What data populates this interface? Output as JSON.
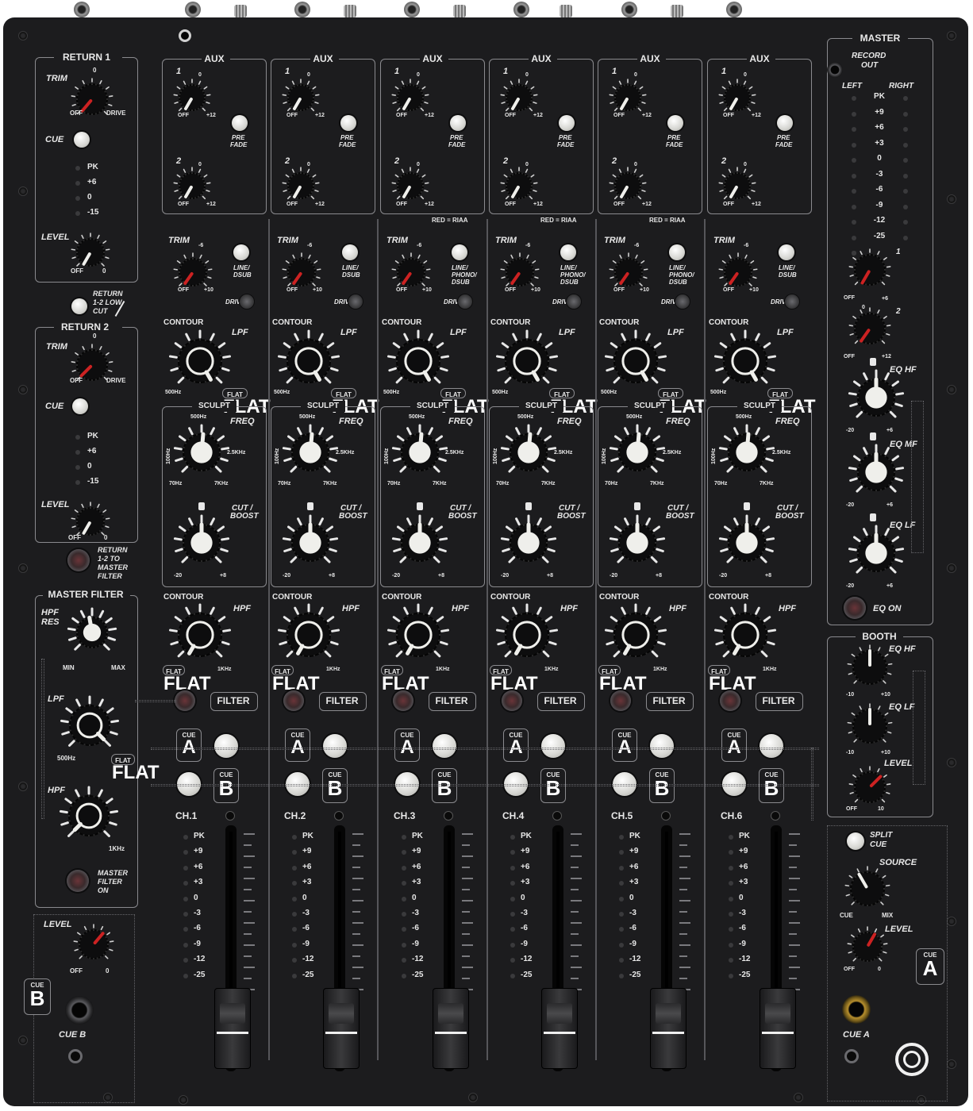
{
  "returns": {
    "r1": {
      "title": "RETURN 1",
      "trim": "TRIM",
      "trim_zero": "0",
      "off": "OFF",
      "drive": "DRIVE",
      "cue": "CUE",
      "meter": [
        "PK",
        "+6",
        "0",
        "-15"
      ],
      "level": "LEVEL",
      "level_off": "OFF",
      "level_zero": "0"
    },
    "r2": {
      "title": "RETURN 2",
      "trim": "TRIM",
      "trim_zero": "0",
      "off": "OFF",
      "drive": "DRIVE",
      "cue": "CUE",
      "meter": [
        "PK",
        "+6",
        "0",
        "-15"
      ],
      "level": "LEVEL",
      "level_off": "OFF",
      "level_zero": "0"
    },
    "low_cut": [
      "RETURN",
      "1-2 LOW",
      "CUT"
    ],
    "to_master": [
      "RETURN",
      "1-2 TO",
      "MASTER",
      "FILTER"
    ]
  },
  "master_filter": {
    "title": "MASTER FILTER",
    "hpf_res": [
      "HPF",
      "RES"
    ],
    "min": "MIN",
    "max": "MAX",
    "lpf": "LPF",
    "lpf_min": "500Hz",
    "flat": "FLAT",
    "hpf": "HPF",
    "hpf_max": "1KHz",
    "on": [
      "MASTER",
      "FILTER",
      "ON"
    ]
  },
  "cue_b_section": {
    "level": "LEVEL",
    "off": "OFF",
    "zero": "0",
    "cue_small": "CUE",
    "cue_letter": "B",
    "jack": "CUE B"
  },
  "channel": {
    "aux_title": "AUX",
    "aux1": "1",
    "aux2": "2",
    "off": "OFF",
    "plus12": "+12",
    "zero": "0",
    "pre_fade": [
      "PRE",
      "FADE"
    ],
    "red_riaa": "RED = RIAA",
    "trim": "TRIM",
    "trim_min": "-6",
    "trim_off": "OFF",
    "trim_max": "+10",
    "drive": "DRIVE",
    "contour": "CONTOUR",
    "lpf": "LPF",
    "hpf": "HPF",
    "hz500": "500Hz",
    "flat": "FLAT",
    "khz1": "1KHz",
    "sculpt": "SCULPT",
    "freq": "FREQ",
    "f500": "500Hz",
    "f100": "100Hz",
    "f25": "2.5KHz",
    "f70": "70Hz",
    "f7k": "7KHz",
    "cut_boost": [
      "CUT /",
      "BOOST"
    ],
    "minus20": "-20",
    "plus8": "+8",
    "filter": "FILTER",
    "cue_small": "CUE",
    "cue_a": "A",
    "cue_b": "B",
    "meter": [
      "PK",
      "+9",
      "+6",
      "+3",
      "0",
      "-3",
      "-6",
      "-9",
      "-12",
      "-25"
    ]
  },
  "channels": [
    {
      "name": "CH.1",
      "source": [
        "LINE/",
        "DSUB"
      ]
    },
    {
      "name": "CH.2",
      "source": [
        "LINE/",
        "DSUB"
      ]
    },
    {
      "name": "CH.3",
      "source": [
        "LINE/",
        "PHONO/",
        "DSUB"
      ]
    },
    {
      "name": "CH.4",
      "source": [
        "LINE/",
        "PHONO/",
        "DSUB"
      ]
    },
    {
      "name": "CH.5",
      "source": [
        "LINE/",
        "PHONO/",
        "DSUB"
      ]
    },
    {
      "name": "CH.6",
      "source": [
        "LINE/",
        "DSUB"
      ]
    }
  ],
  "master": {
    "title": "MASTER",
    "record_out": [
      "RECORD",
      "OUT"
    ],
    "left": "LEFT",
    "right": "RIGHT",
    "meter": [
      "PK",
      "+9",
      "+6",
      "+3",
      "0",
      "-3",
      "-6",
      "-9",
      "-12",
      "-25"
    ],
    "knob1": "1",
    "knob2": "2",
    "off": "OFF",
    "plus6": "+6",
    "plus12": "+12",
    "zero": "0",
    "eq_hf": "EQ HF",
    "eq_mf": "EQ MF",
    "eq_lf": "EQ LF",
    "minus20": "-20",
    "eq_on": "EQ ON"
  },
  "booth": {
    "title": "BOOTH",
    "eq_hf": "EQ HF",
    "eq_lf": "EQ LF",
    "minus10": "-10",
    "plus10": "+10",
    "level": "LEVEL",
    "off": "OFF",
    "ten": "10"
  },
  "cue_a_section": {
    "split_cue": [
      "SPLIT",
      "CUE"
    ],
    "source": "SOURCE",
    "cue": "CUE",
    "mix": "MIX",
    "level": "LEVEL",
    "off": "OFF",
    "zero": "0",
    "cue_small": "CUE",
    "cue_letter": "A",
    "jack": "CUE A"
  },
  "colors": {
    "panel": "#1c1c1e",
    "line": "#8a8a8e",
    "text": "#e8e8e8",
    "button": "#e4e4e0",
    "led": "#3a3a3c",
    "trim_red": "#cc2222",
    "knob": "#0d0d0e"
  }
}
